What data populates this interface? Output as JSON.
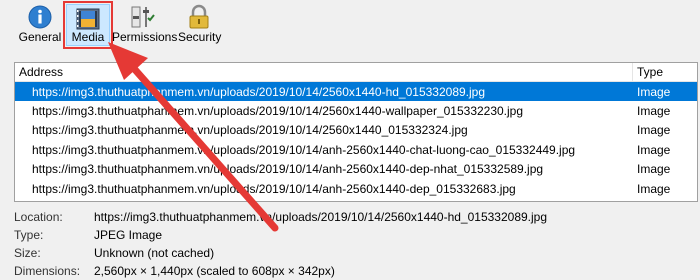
{
  "toolbar": {
    "tabs": [
      {
        "label": "General"
      },
      {
        "label": "Media"
      },
      {
        "label": "Permissions"
      },
      {
        "label": "Security"
      }
    ]
  },
  "media_list": {
    "columns": {
      "address": "Address",
      "type": "Type"
    },
    "rows": [
      {
        "address": "https://img3.thuthuatphanmem.vn/uploads/2019/10/14/2560x1440-hd_015332089.jpg",
        "type": "Image",
        "selected": true
      },
      {
        "address": "https://img3.thuthuatphanmem.vn/uploads/2019/10/14/2560x1440-wallpaper_015332230.jpg",
        "type": "Image"
      },
      {
        "address": "https://img3.thuthuatphanmem.vn/uploads/2019/10/14/2560x1440_015332324.jpg",
        "type": "Image"
      },
      {
        "address": "https://img3.thuthuatphanmem.vn/uploads/2019/10/14/anh-2560x1440-chat-luong-cao_015332449.jpg",
        "type": "Image"
      },
      {
        "address": "https://img3.thuthuatphanmem.vn/uploads/2019/10/14/anh-2560x1440-dep-nhat_015332589.jpg",
        "type": "Image"
      },
      {
        "address": "https://img3.thuthuatphanmem.vn/uploads/2019/10/14/anh-2560x1440-dep_015332683.jpg",
        "type": "Image"
      }
    ]
  },
  "details": {
    "location_label": "Location:",
    "location_value": "https://img3.thuthuatphanmem.vn/uploads/2019/10/14/2560x1440-hd_015332089.jpg",
    "type_label": "Type:",
    "type_value": "JPEG Image",
    "size_label": "Size:",
    "size_value": "Unknown (not cached)",
    "dimensions_label": "Dimensions:",
    "dimensions_value": "2,560px × 1,440px (scaled to 608px × 342px)"
  },
  "colors": {
    "selection": "#0078d7",
    "highlight_box": "#e53935",
    "arrow": "#e53935"
  },
  "icons": [
    "info-icon",
    "media-icon",
    "permissions-icon",
    "lock-icon"
  ]
}
